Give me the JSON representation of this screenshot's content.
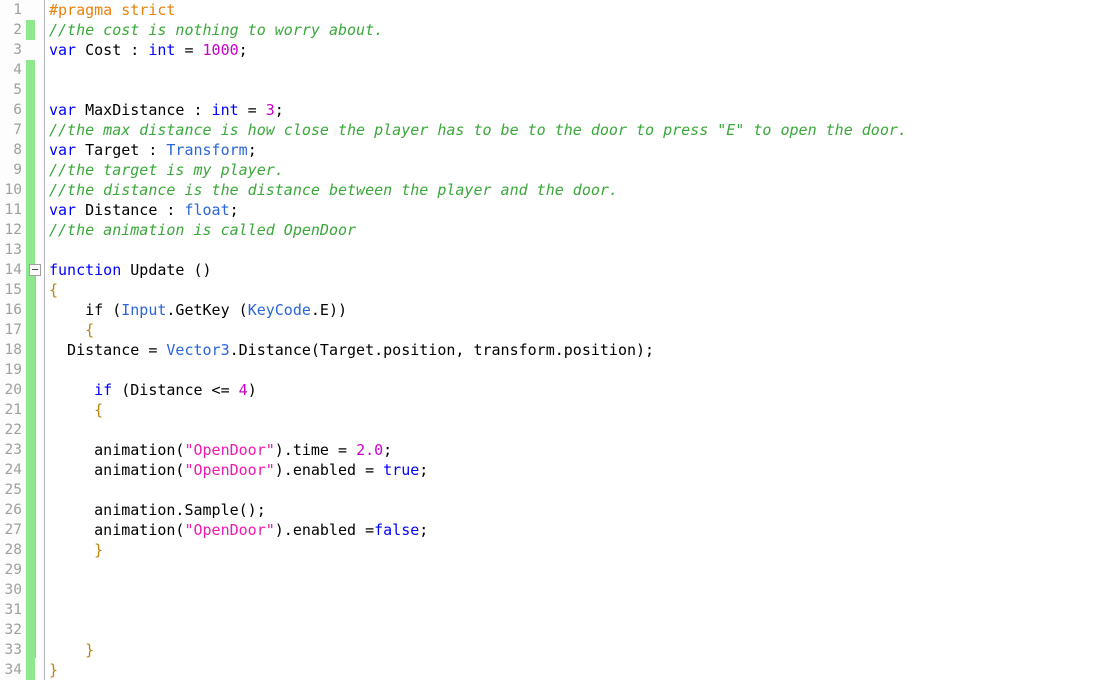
{
  "editor": {
    "name": "code-editor",
    "language": "UnityScript",
    "total_lines": 34,
    "colors": {
      "background": "#ffffff",
      "gutter_background": "#fdfdfe",
      "gutter_border": "#b6b6b6",
      "line_number": "#a0a0a0",
      "change_bar_green": "#8ee88e",
      "keyword": "#0000ff",
      "type": "#2b65d9",
      "number": "#cc00cc",
      "string": "#ee1ab0",
      "comment": "#3aa83a",
      "preprocessor": "#e8820c",
      "brace": "#b8860b",
      "plain_text": "#000000"
    }
  },
  "gutter": {
    "line_numbers": [
      "1",
      "2",
      "3",
      "4",
      "5",
      "6",
      "7",
      "8",
      "9",
      "10",
      "11",
      "12",
      "13",
      "14",
      "15",
      "16",
      "17",
      "18",
      "19",
      "20",
      "21",
      "22",
      "23",
      "24",
      "25",
      "26",
      "27",
      "28",
      "29",
      "30",
      "31",
      "32",
      "33",
      "34"
    ],
    "fold_marker": {
      "line": 14,
      "state": "expanded",
      "glyph": "minus"
    },
    "change_bars": [
      {
        "from_line": 2,
        "to_line": 2
      },
      {
        "from_line": 4,
        "to_line": 34
      }
    ]
  },
  "code_lines": [
    {
      "n": 1,
      "text": "#pragma strict"
    },
    {
      "n": 2,
      "text": "//the cost is nothing to worry about."
    },
    {
      "n": 3,
      "text": "var Cost : int = 1000;"
    },
    {
      "n": 4,
      "text": ""
    },
    {
      "n": 5,
      "text": ""
    },
    {
      "n": 6,
      "text": "var MaxDistance : int = 3;"
    },
    {
      "n": 7,
      "text": "//the max distance is how close the player has to be to the door to press \"E\" to open the door."
    },
    {
      "n": 8,
      "text": "var Target : Transform;"
    },
    {
      "n": 9,
      "text": "//the target is my player."
    },
    {
      "n": 10,
      "text": "//the distance is the distance between the player and the door."
    },
    {
      "n": 11,
      "text": "var Distance : float;"
    },
    {
      "n": 12,
      "text": "//the animation is called OpenDoor"
    },
    {
      "n": 13,
      "text": ""
    },
    {
      "n": 14,
      "text": "function Update ()"
    },
    {
      "n": 15,
      "text": "{"
    },
    {
      "n": 16,
      "text": "    if (Input.GetKey (KeyCode.E))"
    },
    {
      "n": 17,
      "text": "    {"
    },
    {
      "n": 18,
      "text": "  Distance = Vector3.Distance(Target.position, transform.position);"
    },
    {
      "n": 19,
      "text": ""
    },
    {
      "n": 20,
      "text": "     if (Distance <= 4)"
    },
    {
      "n": 21,
      "text": "     {"
    },
    {
      "n": 22,
      "text": ""
    },
    {
      "n": 23,
      "text": "     animation(\"OpenDoor\").time = 2.0;"
    },
    {
      "n": 24,
      "text": "     animation(\"OpenDoor\").enabled = true;"
    },
    {
      "n": 25,
      "text": ""
    },
    {
      "n": 26,
      "text": "     animation.Sample();"
    },
    {
      "n": 27,
      "text": "     animation(\"OpenDoor\").enabled =false;"
    },
    {
      "n": 28,
      "text": "     }"
    },
    {
      "n": 29,
      "text": ""
    },
    {
      "n": 30,
      "text": ""
    },
    {
      "n": 31,
      "text": ""
    },
    {
      "n": 32,
      "text": ""
    },
    {
      "n": 33,
      "text": "    }"
    },
    {
      "n": 34,
      "text": "}"
    }
  ],
  "tokens": {
    "l1": [
      {
        "t": "#pragma strict",
        "c": "prep"
      }
    ],
    "l2": [
      {
        "t": "//the cost is nothing to worry about.",
        "c": "cmt"
      }
    ],
    "l3": [
      {
        "t": "var",
        "c": "kw"
      },
      {
        "t": " Cost : ",
        "c": "plain"
      },
      {
        "t": "int",
        "c": "kw"
      },
      {
        "t": " = ",
        "c": "plain"
      },
      {
        "t": "1000",
        "c": "num"
      },
      {
        "t": ";",
        "c": "plain"
      }
    ],
    "l6": [
      {
        "t": "var",
        "c": "kw"
      },
      {
        "t": " MaxDistance : ",
        "c": "plain"
      },
      {
        "t": "int",
        "c": "kw"
      },
      {
        "t": " = ",
        "c": "plain"
      },
      {
        "t": "3",
        "c": "num"
      },
      {
        "t": ";",
        "c": "plain"
      }
    ],
    "l7": [
      {
        "t": "//the max distance is how close the player has to be to the door to press \"E\" to open the door.",
        "c": "cmt"
      }
    ],
    "l8": [
      {
        "t": "var",
        "c": "kw"
      },
      {
        "t": " Target : ",
        "c": "plain"
      },
      {
        "t": "Transform",
        "c": "type"
      },
      {
        "t": ";",
        "c": "plain"
      }
    ],
    "l9": [
      {
        "t": "//the target is my player.",
        "c": "cmt"
      }
    ],
    "l10": [
      {
        "t": "//the distance is the distance between the player and the door.",
        "c": "cmt"
      }
    ],
    "l11": [
      {
        "t": "var",
        "c": "kw"
      },
      {
        "t": " Distance : ",
        "c": "plain"
      },
      {
        "t": "float",
        "c": "type"
      },
      {
        "t": ";",
        "c": "plain"
      }
    ],
    "l12": [
      {
        "t": "//the animation is called OpenDoor",
        "c": "cmt"
      }
    ],
    "l14": [
      {
        "t": "function",
        "c": "kw"
      },
      {
        "t": " Update ()",
        "c": "plain"
      }
    ],
    "l15": [
      {
        "t": "{",
        "c": "brace"
      }
    ],
    "l16": [
      {
        "t": "    if (",
        "c": "plain"
      },
      {
        "t": "Input",
        "c": "type"
      },
      {
        "t": ".GetKey (",
        "c": "plain"
      },
      {
        "t": "KeyCode",
        "c": "type"
      },
      {
        "t": ".E))",
        "c": "plain"
      }
    ],
    "l17": [
      {
        "t": "    ",
        "c": "plain"
      },
      {
        "t": "{",
        "c": "brace"
      }
    ],
    "l18": [
      {
        "t": "  Distance = ",
        "c": "plain"
      },
      {
        "t": "Vector3",
        "c": "type"
      },
      {
        "t": ".Distance(Target.position, transform.position);",
        "c": "plain"
      }
    ],
    "l20": [
      {
        "t": "     ",
        "c": "plain"
      },
      {
        "t": "if",
        "c": "kw"
      },
      {
        "t": " (Distance <= ",
        "c": "plain"
      },
      {
        "t": "4",
        "c": "num"
      },
      {
        "t": ")",
        "c": "plain"
      }
    ],
    "l21": [
      {
        "t": "     ",
        "c": "plain"
      },
      {
        "t": "{",
        "c": "brace"
      }
    ],
    "l23": [
      {
        "t": "     animation(",
        "c": "plain"
      },
      {
        "t": "\"OpenDoor\"",
        "c": "str"
      },
      {
        "t": ").time = ",
        "c": "plain"
      },
      {
        "t": "2.0",
        "c": "num"
      },
      {
        "t": ";",
        "c": "plain"
      }
    ],
    "l24": [
      {
        "t": "     animation(",
        "c": "plain"
      },
      {
        "t": "\"OpenDoor\"",
        "c": "str"
      },
      {
        "t": ").enabled = ",
        "c": "plain"
      },
      {
        "t": "true",
        "c": "kw"
      },
      {
        "t": ";",
        "c": "plain"
      }
    ],
    "l26": [
      {
        "t": "     animation.Sample();",
        "c": "plain"
      }
    ],
    "l27": [
      {
        "t": "     animation(",
        "c": "plain"
      },
      {
        "t": "\"OpenDoor\"",
        "c": "str"
      },
      {
        "t": ").enabled =",
        "c": "plain"
      },
      {
        "t": "false",
        "c": "kw"
      },
      {
        "t": ";",
        "c": "plain"
      }
    ],
    "l28": [
      {
        "t": "     ",
        "c": "plain"
      },
      {
        "t": "}",
        "c": "brace"
      }
    ],
    "l33": [
      {
        "t": "    ",
        "c": "plain"
      },
      {
        "t": "}",
        "c": "brace"
      }
    ],
    "l34": [
      {
        "t": "}",
        "c": "brace"
      }
    ]
  }
}
